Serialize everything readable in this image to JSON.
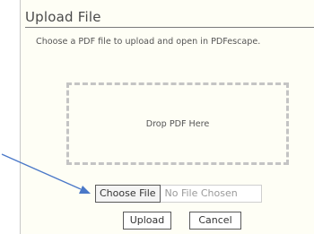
{
  "dialog": {
    "title": "Upload File",
    "subtitle": "Choose a PDF file to upload and open in PDFescape."
  },
  "drop_zone": {
    "label": "Drop PDF Here"
  },
  "file_input": {
    "choose_label": "Choose File",
    "status": "No File Chosen"
  },
  "actions": {
    "upload_label": "Upload",
    "cancel_label": "Cancel"
  },
  "annotation": {
    "arrow_color": "#4a78c8"
  }
}
